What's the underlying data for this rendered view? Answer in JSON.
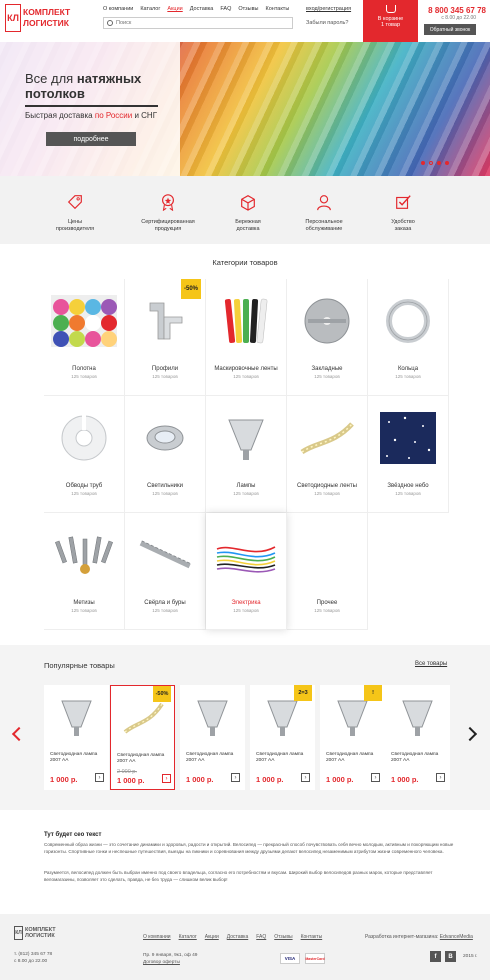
{
  "header": {
    "logo_mark": "КЛ",
    "logo_line1": "КОМПЛЕКТ",
    "logo_line2": "ЛОГИСТИК",
    "nav": [
      "О компании",
      "Каталог",
      "Акции",
      "Доставка",
      "FAQ",
      "Отзывы",
      "Контакты"
    ],
    "nav_active": "Акции",
    "login": "вход/регистрация",
    "search_placeholder": "Поиск",
    "forgot": "Забыли пароль?",
    "cart_line1": "В корзине",
    "cart_line2": "1 товар",
    "phone": "8 800 345 67 78",
    "hours": "с 8.00 до 22.00",
    "callback": "Обратный звонок"
  },
  "hero": {
    "title_line1_a": "Все для ",
    "title_line1_b": "натяжных",
    "title_line2": "потолков",
    "sub_a": "Быстрая доставка ",
    "sub_b": "по России",
    "sub_c": " и СНГ",
    "button": "подробнее"
  },
  "features": [
    {
      "line1": "Цены",
      "line2": "производителя",
      "icon": "price-tag-icon"
    },
    {
      "line1": "Сертифицированная",
      "line2": "продукция",
      "icon": "certificate-icon"
    },
    {
      "line1": "Бережная",
      "line2": "доставка",
      "icon": "box-icon"
    },
    {
      "line1": "Персональное",
      "line2": "обслуживание",
      "icon": "person-icon"
    },
    {
      "line1": "Удобство",
      "line2": "заказа",
      "icon": "checkbox-icon"
    }
  ],
  "categories_title": "Категории товаров",
  "categories": [
    {
      "name": "Полотна",
      "count": "125 товаров"
    },
    {
      "name": "Профили",
      "count": "125 товаров",
      "badge": "-50%"
    },
    {
      "name": "Маскировочные ленты",
      "count": "125 товаров"
    },
    {
      "name": "Закладные",
      "count": "125 товаров"
    },
    {
      "name": "Кольца",
      "count": "125 товаров"
    },
    {
      "name": "Обводы труб",
      "count": "125 товаров"
    },
    {
      "name": "Светильники",
      "count": "125 товаров"
    },
    {
      "name": "Лампы",
      "count": "125 товаров"
    },
    {
      "name": "Светодиодные ленты",
      "count": "125 товаров"
    },
    {
      "name": "Звёздное небо",
      "count": "125 товаров"
    },
    {
      "name": "Метизы",
      "count": "125 товаров"
    },
    {
      "name": "Свёрла и буры",
      "count": "125 товаров"
    },
    {
      "name": "Электрика",
      "count": "125 товаров"
    },
    {
      "name": "Прочее",
      "count": "125 товаров"
    }
  ],
  "popular": {
    "title": "Популярные товары",
    "all": "Все товары",
    "products": [
      {
        "name1": "Светодиодная лампа",
        "name2": "2007 АА",
        "price": "1 000 р."
      },
      {
        "name1": "Светодиодная лампа",
        "name2": "2007 АА",
        "old_price": "2 000 р.",
        "price": "1 000 р.",
        "badge": "-50%"
      },
      {
        "name1": "Светодиодная лампа",
        "name2": "2007 АА",
        "price": "1 000 р."
      },
      {
        "name1": "Светодиодная лампа",
        "name2": "2007 АА",
        "price": "1 000 р.",
        "badge": "2=3"
      },
      {
        "name1": "Светодиодная лампа",
        "name2": "2007 АА",
        "price": "1 000 р.",
        "badge": "!"
      },
      {
        "name1": "Светодиодная лампа",
        "name2": "2007 АА",
        "price": "1 000 р."
      }
    ]
  },
  "seo": {
    "title": "Тут будет сео текст",
    "p1": "Современный образ жизни — это сочетание динамики и здоровья, радости и открытий. Велосипед — прекрасный способ почувствовать себя вечно молодым, активным и покоряющим новые горизонты. Спортивные гонки и неспешные путешествия, выезды на пикники и соревнования между друзьями делают велосипед незаменимым атрибутом жизни современного человека.",
    "p2": "Разумеется, велосипед должен быть выбран именно под своего владельца, согласно его потребностям и вкусам. Широкий выбор велосипедов разных марок, которые представляет веломагазины, позволяет это сделать, правда, не без труда — слишком велик выбор!"
  },
  "footer": {
    "logo_mark": "КЛ",
    "logo_line1": "КОМПЛЕКТ",
    "logo_line2": "ЛОГИСТИК",
    "phone": "т. (812) 345 67 78",
    "hours": "с 8.00 до 22.00",
    "nav": [
      "О компании",
      "Каталог",
      "Акции",
      "Доставка",
      "FAQ",
      "Отзывы",
      "Контакты"
    ],
    "address": "Пр. 9 января, 9к1, оф 49",
    "offer": "Договор оферты",
    "visa": "VISA",
    "mastercard": "MasterCard",
    "dev_label": "Разработка интернет-магазина: ",
    "dev_name": "EdvanceMedia",
    "social_fb": "f",
    "social_vk": "В",
    "year": "2015 г."
  }
}
